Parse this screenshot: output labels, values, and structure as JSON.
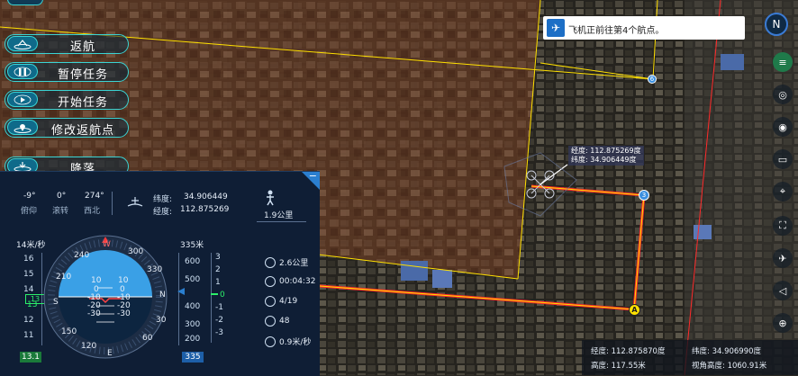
{
  "nav_buttons": [
    {
      "label": "返航",
      "icon": "home-return-icon"
    },
    {
      "label": "暂停任务",
      "icon": "pause-icon"
    },
    {
      "label": "开始任务",
      "icon": "play-icon"
    },
    {
      "label": "修改返航点",
      "icon": "location-pin-icon"
    },
    {
      "label": "降落",
      "icon": "land-icon"
    }
  ],
  "notice": {
    "text": "飞机正前往第4个航点。"
  },
  "coord_tooltip": {
    "lng": "经度:  112.875269度",
    "lat": "纬度:  34.906449度"
  },
  "waypoints": {
    "wp6": "6",
    "wp3": "3",
    "home": "A"
  },
  "attitude": [
    {
      "value": "-9°",
      "label": "俯仰"
    },
    {
      "value": "0°",
      "label": "滚转"
    },
    {
      "value": "274°",
      "label": "西北"
    }
  ],
  "position": {
    "lat_label": "纬度:",
    "lat_value": "34.906449",
    "lng_label": "经度:",
    "lng_value": "112.875269"
  },
  "distance_home": "1.9公里",
  "speed_header": "14米/秒",
  "altitude_header": "335米",
  "speed_scale": [
    "16",
    "15",
    "14",
    "13",
    "12",
    "11"
  ],
  "speed_current": "13",
  "speed_readout": "13.1",
  "altitude_scale": [
    "600",
    "500",
    "400",
    "300",
    "200"
  ],
  "altitude_current": "335",
  "vertical_scale": [
    "3",
    "2",
    "1",
    "0",
    "-1",
    "-2",
    "-3"
  ],
  "vertical_current": "0",
  "compass_labels": [
    "W",
    "300",
    "330",
    "N",
    "30",
    "60",
    "E",
    "120",
    "150",
    "S",
    "210",
    "240"
  ],
  "pitch_ladder": [
    "10",
    "0",
    "-10",
    "-20",
    "-30"
  ],
  "stats": [
    {
      "icon": "distance-icon",
      "value": "2.6公里"
    },
    {
      "icon": "clock-icon",
      "value": "00:04:32"
    },
    {
      "icon": "waypoint-icon",
      "value": "4/19"
    },
    {
      "icon": "satellite-icon",
      "value": "48"
    },
    {
      "icon": "wind-speed-icon",
      "value": "0.9米/秒"
    }
  ],
  "status_bar": {
    "lng": "经度:  112.875870度",
    "lat": "纬度:  34.906990度",
    "height": "高度:  117.55米",
    "view_height": "视角高度:  1060.91米"
  },
  "right_tools": [
    "compass-north-icon",
    "layers-icon",
    "map-type-icon",
    "camera-icon",
    "measure-icon",
    "ruler-icon",
    "location-icon",
    "fullscreen-icon",
    "satellite-track-icon",
    "speaker-icon",
    "globe-icon"
  ],
  "colors": {
    "route_red": "#ff2a2a",
    "route_yellow": "#ffe000",
    "accent": "#3ad4d4",
    "panel_bg": "#0f1e35",
    "sky": "#3aa0e6",
    "ground": "#0d2540"
  }
}
